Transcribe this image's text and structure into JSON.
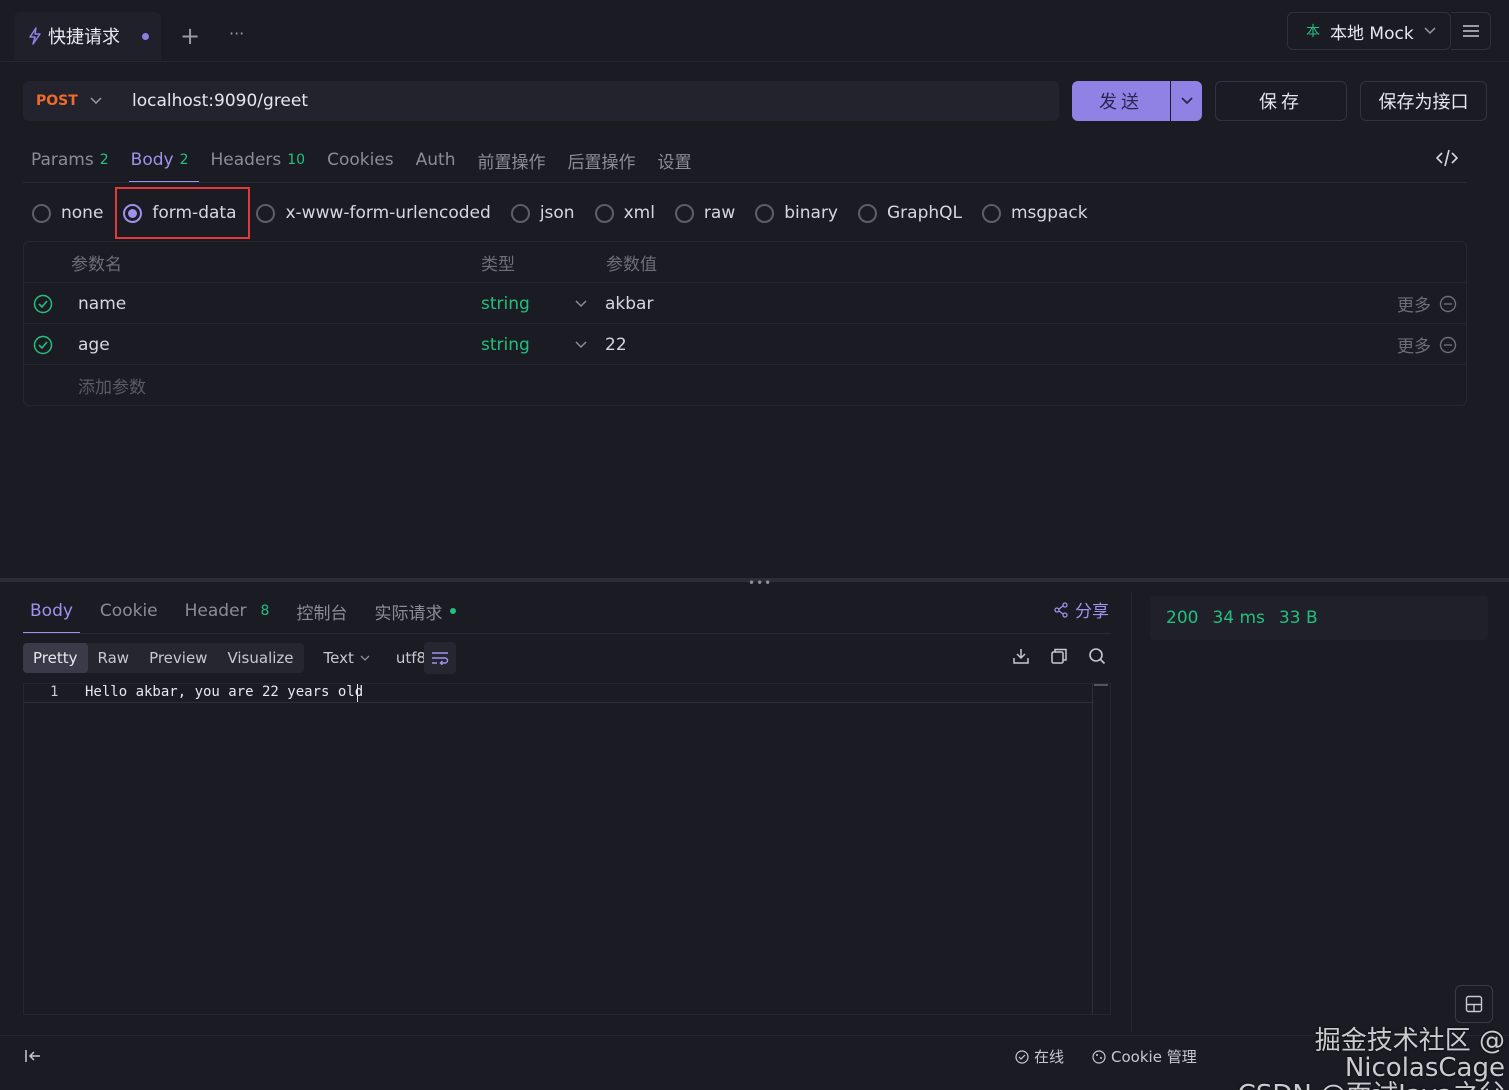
{
  "top_bar": {
    "tab_title": "快捷请求",
    "add_label": "+",
    "more_label": "···",
    "env_icon_char": "本",
    "env_label": "本地 Mock"
  },
  "request": {
    "method": "POST",
    "url": "localhost:9090/greet",
    "send_label": "发送",
    "save_label": "保存",
    "save_api_label": "保存为接口"
  },
  "request_tabs": [
    {
      "label": "Params",
      "count": "2"
    },
    {
      "label": "Body",
      "count": "2"
    },
    {
      "label": "Headers",
      "count": "10"
    },
    {
      "label": "Cookies",
      "count": ""
    },
    {
      "label": "Auth",
      "count": ""
    },
    {
      "label": "前置操作",
      "count": ""
    },
    {
      "label": "后置操作",
      "count": ""
    },
    {
      "label": "设置",
      "count": ""
    }
  ],
  "body_types": [
    "none",
    "form-data",
    "x-www-form-urlencoded",
    "json",
    "xml",
    "raw",
    "binary",
    "GraphQL",
    "msgpack"
  ],
  "body_type_selected": "form-data",
  "params_table": {
    "headers": {
      "name": "参数名",
      "type": "类型",
      "value": "参数值"
    },
    "rows": [
      {
        "name": "name",
        "type": "string",
        "value": "akbar",
        "more": "更多"
      },
      {
        "name": "age",
        "type": "string",
        "value": "22",
        "more": "更多"
      }
    ],
    "add_placeholder": "添加参数"
  },
  "response_tabs": [
    {
      "label": "Body",
      "count": ""
    },
    {
      "label": "Cookie",
      "count": ""
    },
    {
      "label": "Header",
      "count": "8"
    },
    {
      "label": "控制台",
      "count": ""
    },
    {
      "label": "实际请求",
      "count": ""
    }
  ],
  "share_label": "分享",
  "format_bar": {
    "modes": [
      "Pretty",
      "Raw",
      "Preview",
      "Visualize"
    ],
    "selected_mode": "Pretty",
    "type_label": "Text",
    "encoding_label": "utf8"
  },
  "response_body": {
    "line_number": "1",
    "text": "Hello akbar, you are 22 years old"
  },
  "status": {
    "code": "200",
    "time": "34 ms",
    "size": "33 B"
  },
  "footer": {
    "online_label": "在线",
    "cookie_label": "Cookie 管理"
  },
  "watermark": {
    "line1": "掘金技术社区 @ NicolasCage",
    "line2": "CSDN @面试Java之父"
  },
  "colors": {
    "accent": "#9d92ec",
    "send_button": "#8f82e4",
    "method_post": "#f06a2c",
    "success": "#22c07c",
    "highlight_box": "#e23a3a"
  }
}
